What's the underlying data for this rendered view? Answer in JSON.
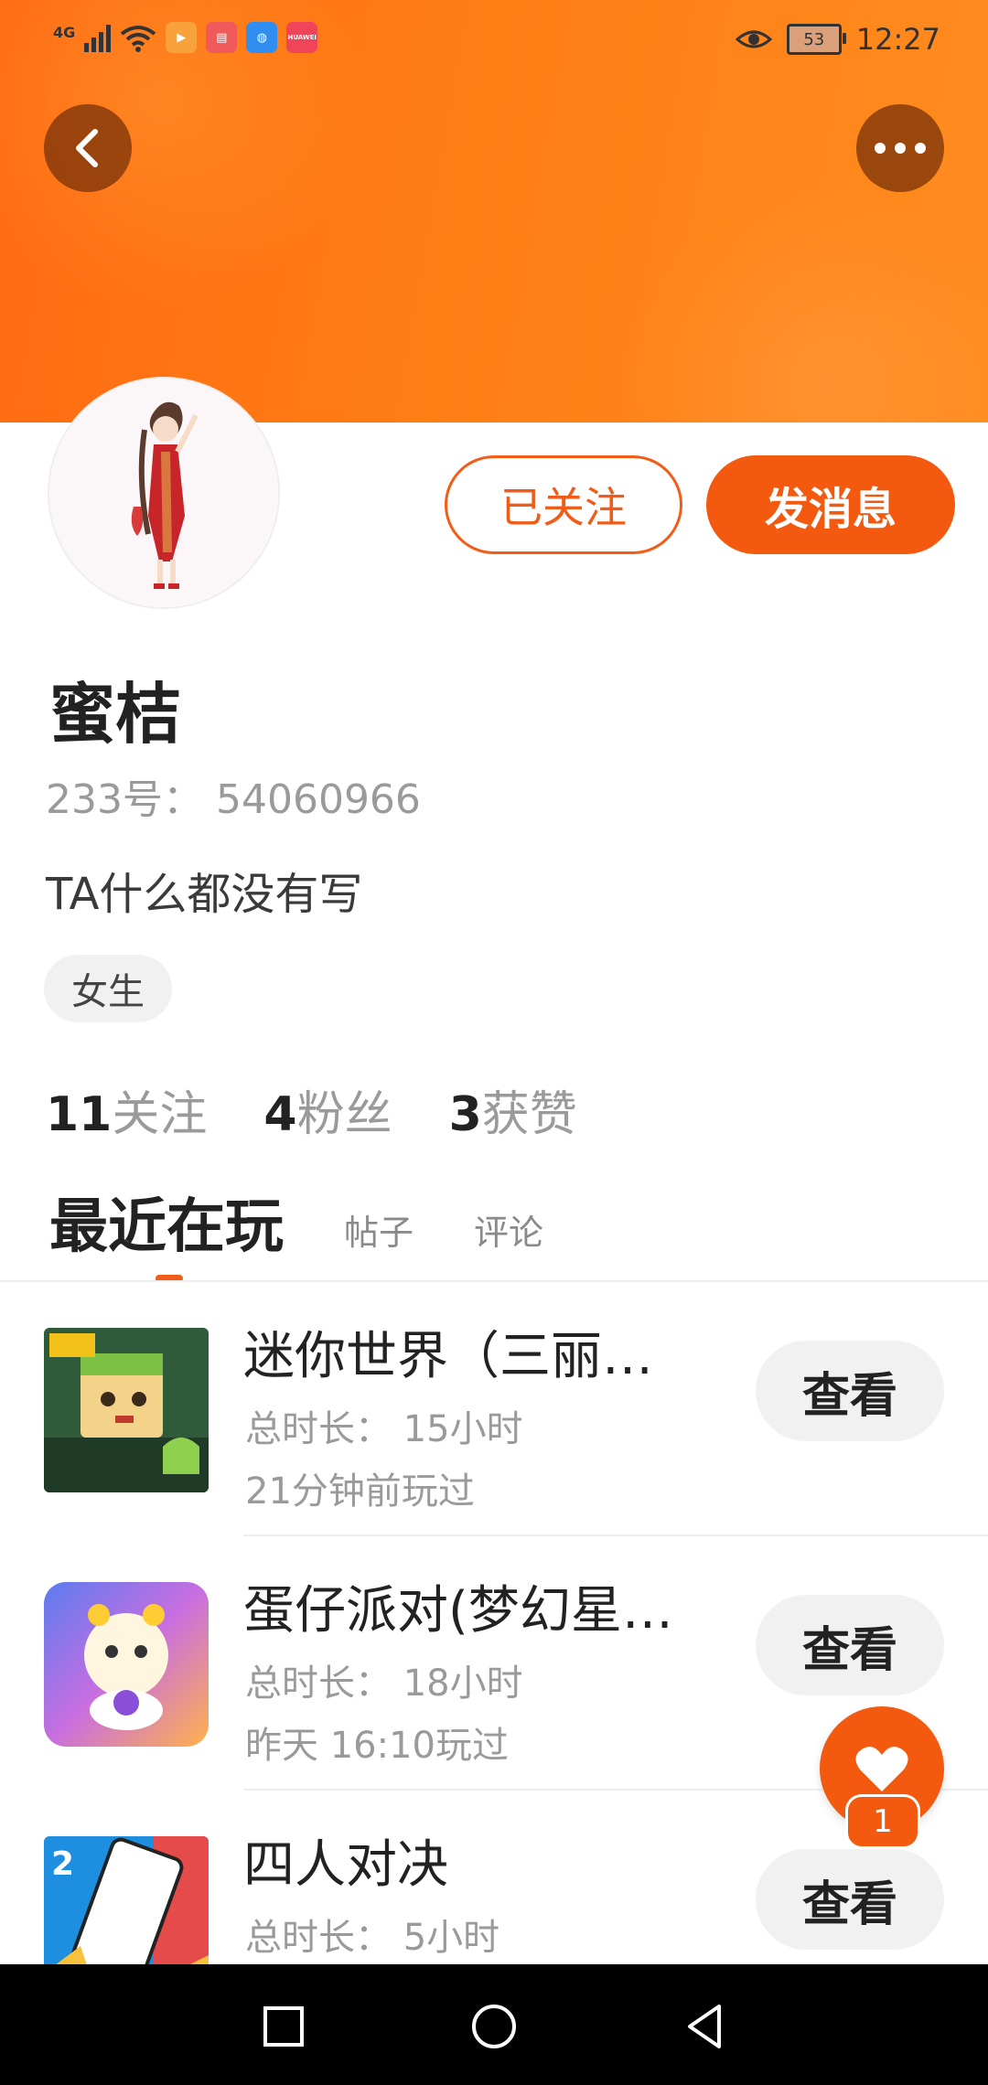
{
  "status_bar": {
    "network": "4G",
    "app_icons": [
      "play-store-icon",
      "book-app-icon",
      "browser-app-icon",
      "huawei-app-icon"
    ],
    "huawei_label": "HUAWEI",
    "battery": "53",
    "time": "12:27"
  },
  "profile": {
    "follow_button": "已关注",
    "message_button": "发消息",
    "name": "蜜桔",
    "uid": "233号： 54060966",
    "bio": "TA什么都没有写",
    "gender_tag": "女生",
    "stats": [
      {
        "number": "11",
        "label": "关注"
      },
      {
        "number": "4",
        "label": "粉丝"
      },
      {
        "number": "3",
        "label": "获赞"
      }
    ]
  },
  "tabs": [
    "最近在玩",
    "帖子",
    "评论"
  ],
  "games": [
    {
      "title": "迷你世界（三丽…",
      "duration": "总时长： 15小时",
      "last_played": "21分钟前玩过",
      "button": "查看"
    },
    {
      "title": "蛋仔派对(梦幻星…",
      "duration": "总时长： 18小时",
      "last_played": "昨天 16:10玩过",
      "button": "查看"
    },
    {
      "title": "四人对决",
      "duration": "总时长： 5小时",
      "last_played": "",
      "button": "查看"
    }
  ],
  "fab": {
    "badge": "1"
  },
  "colors": {
    "accent": "#f35a10",
    "header": "#ff7a14"
  }
}
